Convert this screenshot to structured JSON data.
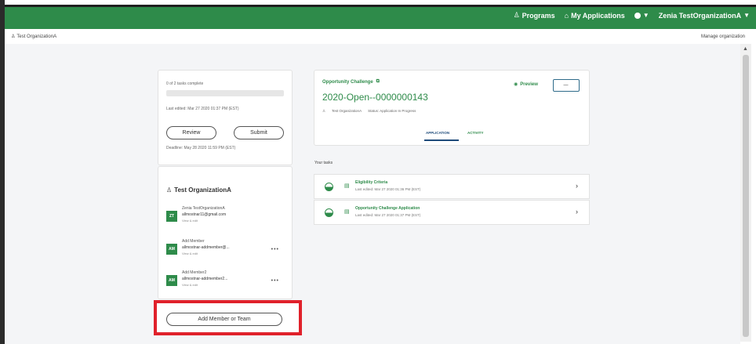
{
  "header": {
    "programs": "Programs",
    "my_applications": "My Applications",
    "user_name": "Zenia TestOrganizationA",
    "programs_icon": "person-icon",
    "apps_icon": "home-icon"
  },
  "org_bar": {
    "org_name": "Test OrganizationA",
    "manage": "Manage organization"
  },
  "progress": {
    "tasks_complete": "0 of 2 tasks complete",
    "progress_fraction": 0,
    "last_edited": "Last edited: Mar 27 2020 01:37 PM (EST)",
    "review_label": "Review",
    "submit_label": "Submit",
    "deadline": "Deadline: May 28 2020 11:59 PM (EST)"
  },
  "team": {
    "title": "Test OrganizationA",
    "members": [
      {
        "initials": "ZT",
        "name": "Zenia TestOrganizationA",
        "email": "allmostnar11@gmail.com",
        "view": "View & edit"
      },
      {
        "initials": "AM",
        "name": "Add Member",
        "email": "allmostnar-addmember@...",
        "view": "View & edit"
      },
      {
        "initials": "AM",
        "name": "Add Member2",
        "email": "allmostnar-addmember2...",
        "view": "View & edit"
      }
    ],
    "add_button": "Add Member or Team"
  },
  "opportunity": {
    "title": "Opportunity Challenge",
    "code": "2020-Open--0000000143",
    "org": "Test OrganizationA",
    "status": "Status: Application In Progress",
    "preview": "Preview",
    "more": "—",
    "tab_application": "APPLICATION",
    "tab_activity": "ACTIVITY"
  },
  "tasks": {
    "label": "Your tasks",
    "items": [
      {
        "name": "Eligibility Criteria",
        "edited": "Last edited: Mar 27 2020 01:36 PM (EST)"
      },
      {
        "name": "Opportunity Challenge Application",
        "edited": "Last edited: Mar 27 2020 01:37 PM (EST)"
      }
    ]
  },
  "colors": {
    "brand_green": "#2e8b4a",
    "highlight_red": "#e0212b",
    "tab_blue": "#1e4b7a"
  }
}
